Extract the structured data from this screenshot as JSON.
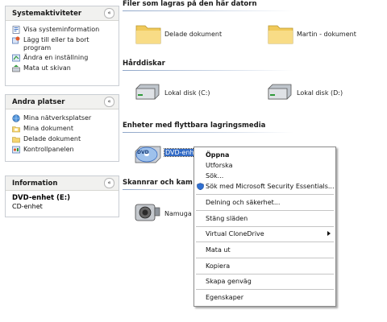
{
  "panes": {
    "system": {
      "title": "Systemaktiviteter",
      "items": [
        "Visa systeminformation",
        "Lägg till eller ta bort program",
        "Ändra en inställning",
        "Mata ut skivan"
      ]
    },
    "places": {
      "title": "Andra platser",
      "items": [
        "Mina nätverksplatser",
        "Mina dokument",
        "Delade dokument",
        "Kontrollpanelen"
      ]
    },
    "info": {
      "title": "Information",
      "name": "DVD-enhet (E:)",
      "type": "CD-enhet"
    }
  },
  "groups": {
    "files": {
      "title": "Filer som lagras på den här datorn",
      "items": [
        "Delade dokument",
        "Martin - dokument"
      ]
    },
    "disks": {
      "title": "Hårddiskar",
      "items": [
        "Lokal disk (C:)",
        "Lokal disk (D:)"
      ]
    },
    "removable": {
      "title": "Enheter med flyttbara lagringsmedia",
      "items": [
        "DVD-enhe"
      ]
    },
    "scanners": {
      "title": "Skannrar och kam",
      "items": [
        "Namuga 1"
      ]
    }
  },
  "context_menu": {
    "items": [
      "Öppna",
      "Utforska",
      "Sök...",
      "Sök med Microsoft Security Essentials...",
      "Delning och säkerhet...",
      "Stäng släden",
      "Virtual CloneDrive",
      "Mata ut",
      "Kopiera",
      "Skapa genväg",
      "Egenskaper"
    ]
  },
  "dvd_badge": "DVD",
  "collapse_glyph": "«",
  "colors": {
    "selection": "#316ac5",
    "folder": "#f5d470",
    "header_line": "#8fa6c8"
  }
}
